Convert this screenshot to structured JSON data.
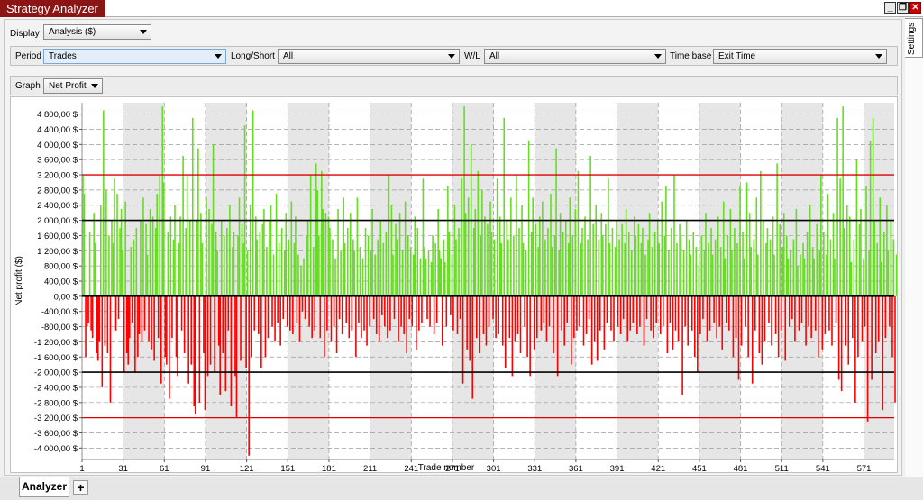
{
  "window": {
    "title": "Strategy Analyzer",
    "settings_tab": "Settings",
    "btn_min": "_",
    "btn_restore": "❐",
    "btn_close": "✕"
  },
  "toolbar": {
    "display_label": "Display",
    "display_value": "Analysis ($)",
    "period_label": "Period",
    "period_value": "Trades",
    "longshort_label": "Long/Short",
    "longshort_value": "All",
    "wl_label": "W/L",
    "wl_value": "All",
    "timebase_label": "Time base",
    "timebase_value": "Exit Time",
    "graph_label": "Graph",
    "graph_value": "Net Profit"
  },
  "bottom_tabs": {
    "analyzer": "Analyzer",
    "add": "+"
  },
  "colors": {
    "positive": "#66dd22",
    "negative": "#ff0000",
    "title_bg": "#8b1515",
    "band": "#e6e6e6"
  },
  "chart_data": {
    "type": "bar",
    "xlabel": "Trade number",
    "ylabel": "Net profit ($)",
    "ylim": [
      -4300,
      5100
    ],
    "xlim": [
      1,
      593
    ],
    "x_ticks": [
      1,
      31,
      61,
      91,
      121,
      151,
      181,
      211,
      241,
      271,
      301,
      331,
      361,
      391,
      421,
      451,
      481,
      511,
      541,
      571
    ],
    "x_tick_labels": [
      "1",
      "31",
      "61",
      "91",
      "121",
      "151",
      "181",
      "211",
      "241",
      "271",
      "301",
      "331",
      "361",
      "391",
      "421",
      "451",
      "481",
      "511",
      "541",
      "571"
    ],
    "y_ticks": [
      4800,
      4400,
      4000,
      3600,
      3200,
      2800,
      2400,
      2000,
      1600,
      1200,
      800,
      400,
      0,
      -400,
      -800,
      -1200,
      -1600,
      -2000,
      -2400,
      -2800,
      -3200,
      -3600,
      -4000
    ],
    "y_tick_labels": [
      "4 800,00 $",
      "4 400,00 $",
      "4 000,00 $",
      "3 600,00 $",
      "3 200,00 $",
      "2 800,00 $",
      "2 400,00 $",
      "2 000,00 $",
      "1 600,00 $",
      "1 200,00 $",
      "800,00 $",
      "400,00 $",
      "0,00 $",
      "-400,00 $",
      "-800,00 $",
      "-1 200,00 $",
      "-1 600,00 $",
      "-2 000,00 $",
      "-2 400,00 $",
      "-2 800,00 $",
      "-3 200,00 $",
      "-3 600,00 $",
      "-4 000,00 $"
    ],
    "reference_lines": [
      {
        "value": 3200,
        "color": "#dd0000"
      },
      {
        "value": 2000,
        "color": "#000000"
      },
      {
        "value": 0,
        "color": "#000000"
      },
      {
        "value": -2000,
        "color": "#000000"
      },
      {
        "value": -3200,
        "color": "#dd0000"
      }
    ],
    "series": [
      {
        "values": [
          3200,
          2700,
          -1600,
          -800,
          -700,
          1700,
          -900,
          -1100,
          2200,
          1400,
          -1500,
          -1700,
          -1200,
          2400,
          -2400,
          4900,
          -1300,
          2800,
          -1500,
          1600,
          -2800,
          2000,
          1400,
          3100,
          -900,
          2700,
          -600,
          1800,
          2300,
          1200,
          -2000,
          2500,
          -1500,
          -1800,
          -1100,
          1300,
          -700,
          1500,
          -2000,
          1800,
          -1600,
          -1000,
          2000,
          -1200,
          2600,
          -900,
          1900,
          1100,
          -1200,
          2300,
          -1400,
          2100,
          -1700,
          1800,
          2700,
          -1100,
          3200,
          -2300,
          5000,
          3000,
          -1600,
          -1800,
          1700,
          -2700,
          2100,
          -1100,
          1500,
          2400,
          -1600,
          -2100,
          1400,
          2100,
          -900,
          3700,
          -1500,
          1800,
          3200,
          -2300,
          2000,
          -1800,
          4700,
          -2900,
          -3100,
          2000,
          3900,
          -2800,
          2200,
          1400,
          -1500,
          -3000,
          2600,
          -2100,
          2300,
          -1800,
          1900,
          4000,
          -2000,
          1700,
          1200,
          -1300,
          -2600,
          2000,
          -1500,
          1600,
          -2500,
          1800,
          -900,
          2400,
          -2900,
          1300,
          1700,
          -2100,
          -3200,
          1600,
          2600,
          -1700,
          1900,
          1400,
          4500,
          -1900,
          1200,
          -4200,
          2400,
          -1600,
          4900,
          -900,
          2100,
          1500,
          -1000,
          1700,
          -1900,
          1900,
          2300,
          -1600,
          1300,
          -1100,
          2000,
          2400,
          -800,
          1100,
          -1200,
          2700,
          -700,
          1400,
          -1300,
          1800,
          -600,
          1200,
          2200,
          -800,
          1500,
          -900,
          2500,
          -1000,
          1400,
          2100,
          -700,
          1100,
          -1200,
          800,
          -400,
          1000,
          -600,
          1600,
          2000,
          -800,
          3200,
          -1100,
          1300,
          -900,
          3500,
          2800,
          1600,
          -1100,
          3300,
          2300,
          -1600,
          2200,
          -900,
          2100,
          1800,
          -1200,
          1500,
          -800,
          1000,
          -1500,
          2300,
          -600,
          1200,
          -1000,
          2600,
          1400,
          -700,
          1800,
          -1100,
          2200,
          -900,
          1500,
          1200,
          -1600,
          2600,
          -700,
          1300,
          -1100,
          1000,
          -900,
          1800,
          -1300,
          1600,
          -800,
          1200,
          2300,
          -600,
          1100,
          -1000,
          1500,
          -1200,
          2000,
          -500,
          1400,
          -800,
          1700,
          -1100,
          3200,
          -900,
          2400,
          1100,
          -600,
          1900,
          1500,
          -1200,
          2200,
          -800,
          1200,
          -1000,
          2500,
          -1500,
          1600,
          -600,
          1300,
          -800,
          1100,
          2100,
          -1400,
          1800,
          -900,
          1000,
          -700,
          3100,
          1300,
          1000,
          -600,
          1200,
          -800,
          900,
          1600,
          -1000,
          1400,
          -700,
          2300,
          1200,
          1000,
          -1300,
          1500,
          900,
          -800,
          2900,
          1700,
          -500,
          1100,
          -900,
          2400,
          1500,
          -1000,
          1800,
          -600,
          3100,
          -2300,
          5000,
          2200,
          -1400,
          2600,
          -1700,
          4000,
          -2700,
          1800,
          2300,
          -1100,
          3300,
          -1500,
          1600,
          2800,
          -1000,
          2100,
          -1300,
          1900,
          -800,
          2500,
          1700,
          -600,
          1500,
          -1100,
          3100,
          -1000,
          2100,
          1400,
          -1300,
          4700,
          -1900,
          2000,
          1500,
          -1100,
          2600,
          -2100,
          1600,
          -1200,
          3200,
          -1000,
          1800,
          -1500,
          2400,
          1400,
          -800,
          1200,
          -1600,
          4100,
          -2100,
          1700,
          2600,
          -1400,
          1900,
          -1100,
          1300,
          2100,
          -900,
          2500,
          -700,
          1500,
          -1200,
          1800,
          -800,
          2700,
          1300,
          -1500,
          1600,
          3900,
          -2100,
          1200,
          2200,
          -900,
          1700,
          -1300,
          2000,
          -700,
          1400,
          2600,
          -1800,
          1600,
          -1100,
          2300,
          -900,
          3300,
          -800,
          1400,
          1800,
          -1300,
          2100,
          -1000,
          1500,
          -600,
          3700,
          -1800,
          1900,
          -1200,
          2400,
          -1700,
          1500,
          -900,
          2200,
          1600,
          -1400,
          1900,
          -700,
          3100,
          1400,
          -900,
          1800,
          -1200,
          1300,
          2000,
          -800,
          1500,
          -1000,
          1900,
          -600,
          1400,
          2300,
          -1200,
          1700,
          -900,
          1200,
          -700,
          2100,
          1600,
          -1000,
          1900,
          -800,
          1400,
          1800,
          -1300,
          1100,
          -600,
          1500,
          2200,
          -900,
          1300,
          -1100,
          1700,
          -700,
          2000,
          1400,
          -1000,
          2500,
          -800,
          1600,
          2900,
          -1500,
          1200,
          -700,
          1800,
          -1400,
          3200,
          -900,
          1400,
          -1200,
          1900,
          1600,
          -2600,
          1200,
          -800,
          2000,
          -1300,
          1500,
          1100,
          -900,
          1700,
          -1600,
          1300,
          -2000,
          800,
          -1000,
          1600,
          -600,
          1200,
          2200,
          -1200,
          1400,
          -900,
          1800,
          1100,
          -700,
          1500,
          -1100,
          2100,
          -800,
          1300,
          -1400,
          2500,
          1000,
          -700,
          1600,
          -900,
          2300,
          1200,
          -1600,
          1800,
          -1100,
          1400,
          -2200,
          2900,
          -1300,
          1700,
          1000,
          -800,
          3000,
          -1600,
          2200,
          1300,
          -2300,
          1500,
          -900,
          2600,
          1100,
          -1500,
          3300,
          -1800,
          2000,
          -1200,
          1400,
          1800,
          -700,
          1500,
          -1300,
          2100,
          1100,
          -1000,
          3500,
          -1600,
          1900,
          -900,
          1300,
          2200,
          -1700,
          1600,
          1000,
          -800,
          1200,
          -600,
          1500,
          -1200,
          2300,
          800,
          -900,
          1100,
          -700,
          1400,
          1000,
          -1300,
          1700,
          -800,
          2400,
          -1100,
          1300,
          1000,
          -900,
          1900,
          -1600,
          1200,
          3200,
          -1400,
          1700,
          -1000,
          1100,
          2700,
          -900,
          1500,
          -1300,
          2200,
          1000,
          -700,
          4700,
          -2200,
          3100,
          -2500,
          5000,
          1800,
          -1300,
          2400,
          -1800,
          2100,
          900,
          -1100,
          1500,
          -2800,
          3600,
          -1600,
          1900,
          2300,
          -1200,
          1000,
          -800,
          2900,
          -3300,
          1200,
          4100,
          -2200,
          4700,
          2000,
          -1500,
          1400,
          -1200,
          2600,
          900,
          -3000,
          1700,
          -1100,
          2400,
          1200,
          -800,
          2000,
          -1600,
          1500,
          -2800,
          1100,
          -1300,
          1800,
          900,
          -1000,
          1300,
          1700,
          -2900,
          1000,
          -900,
          2000,
          600,
          -800,
          1100,
          1500,
          -2000,
          900
        ]
      }
    ]
  }
}
